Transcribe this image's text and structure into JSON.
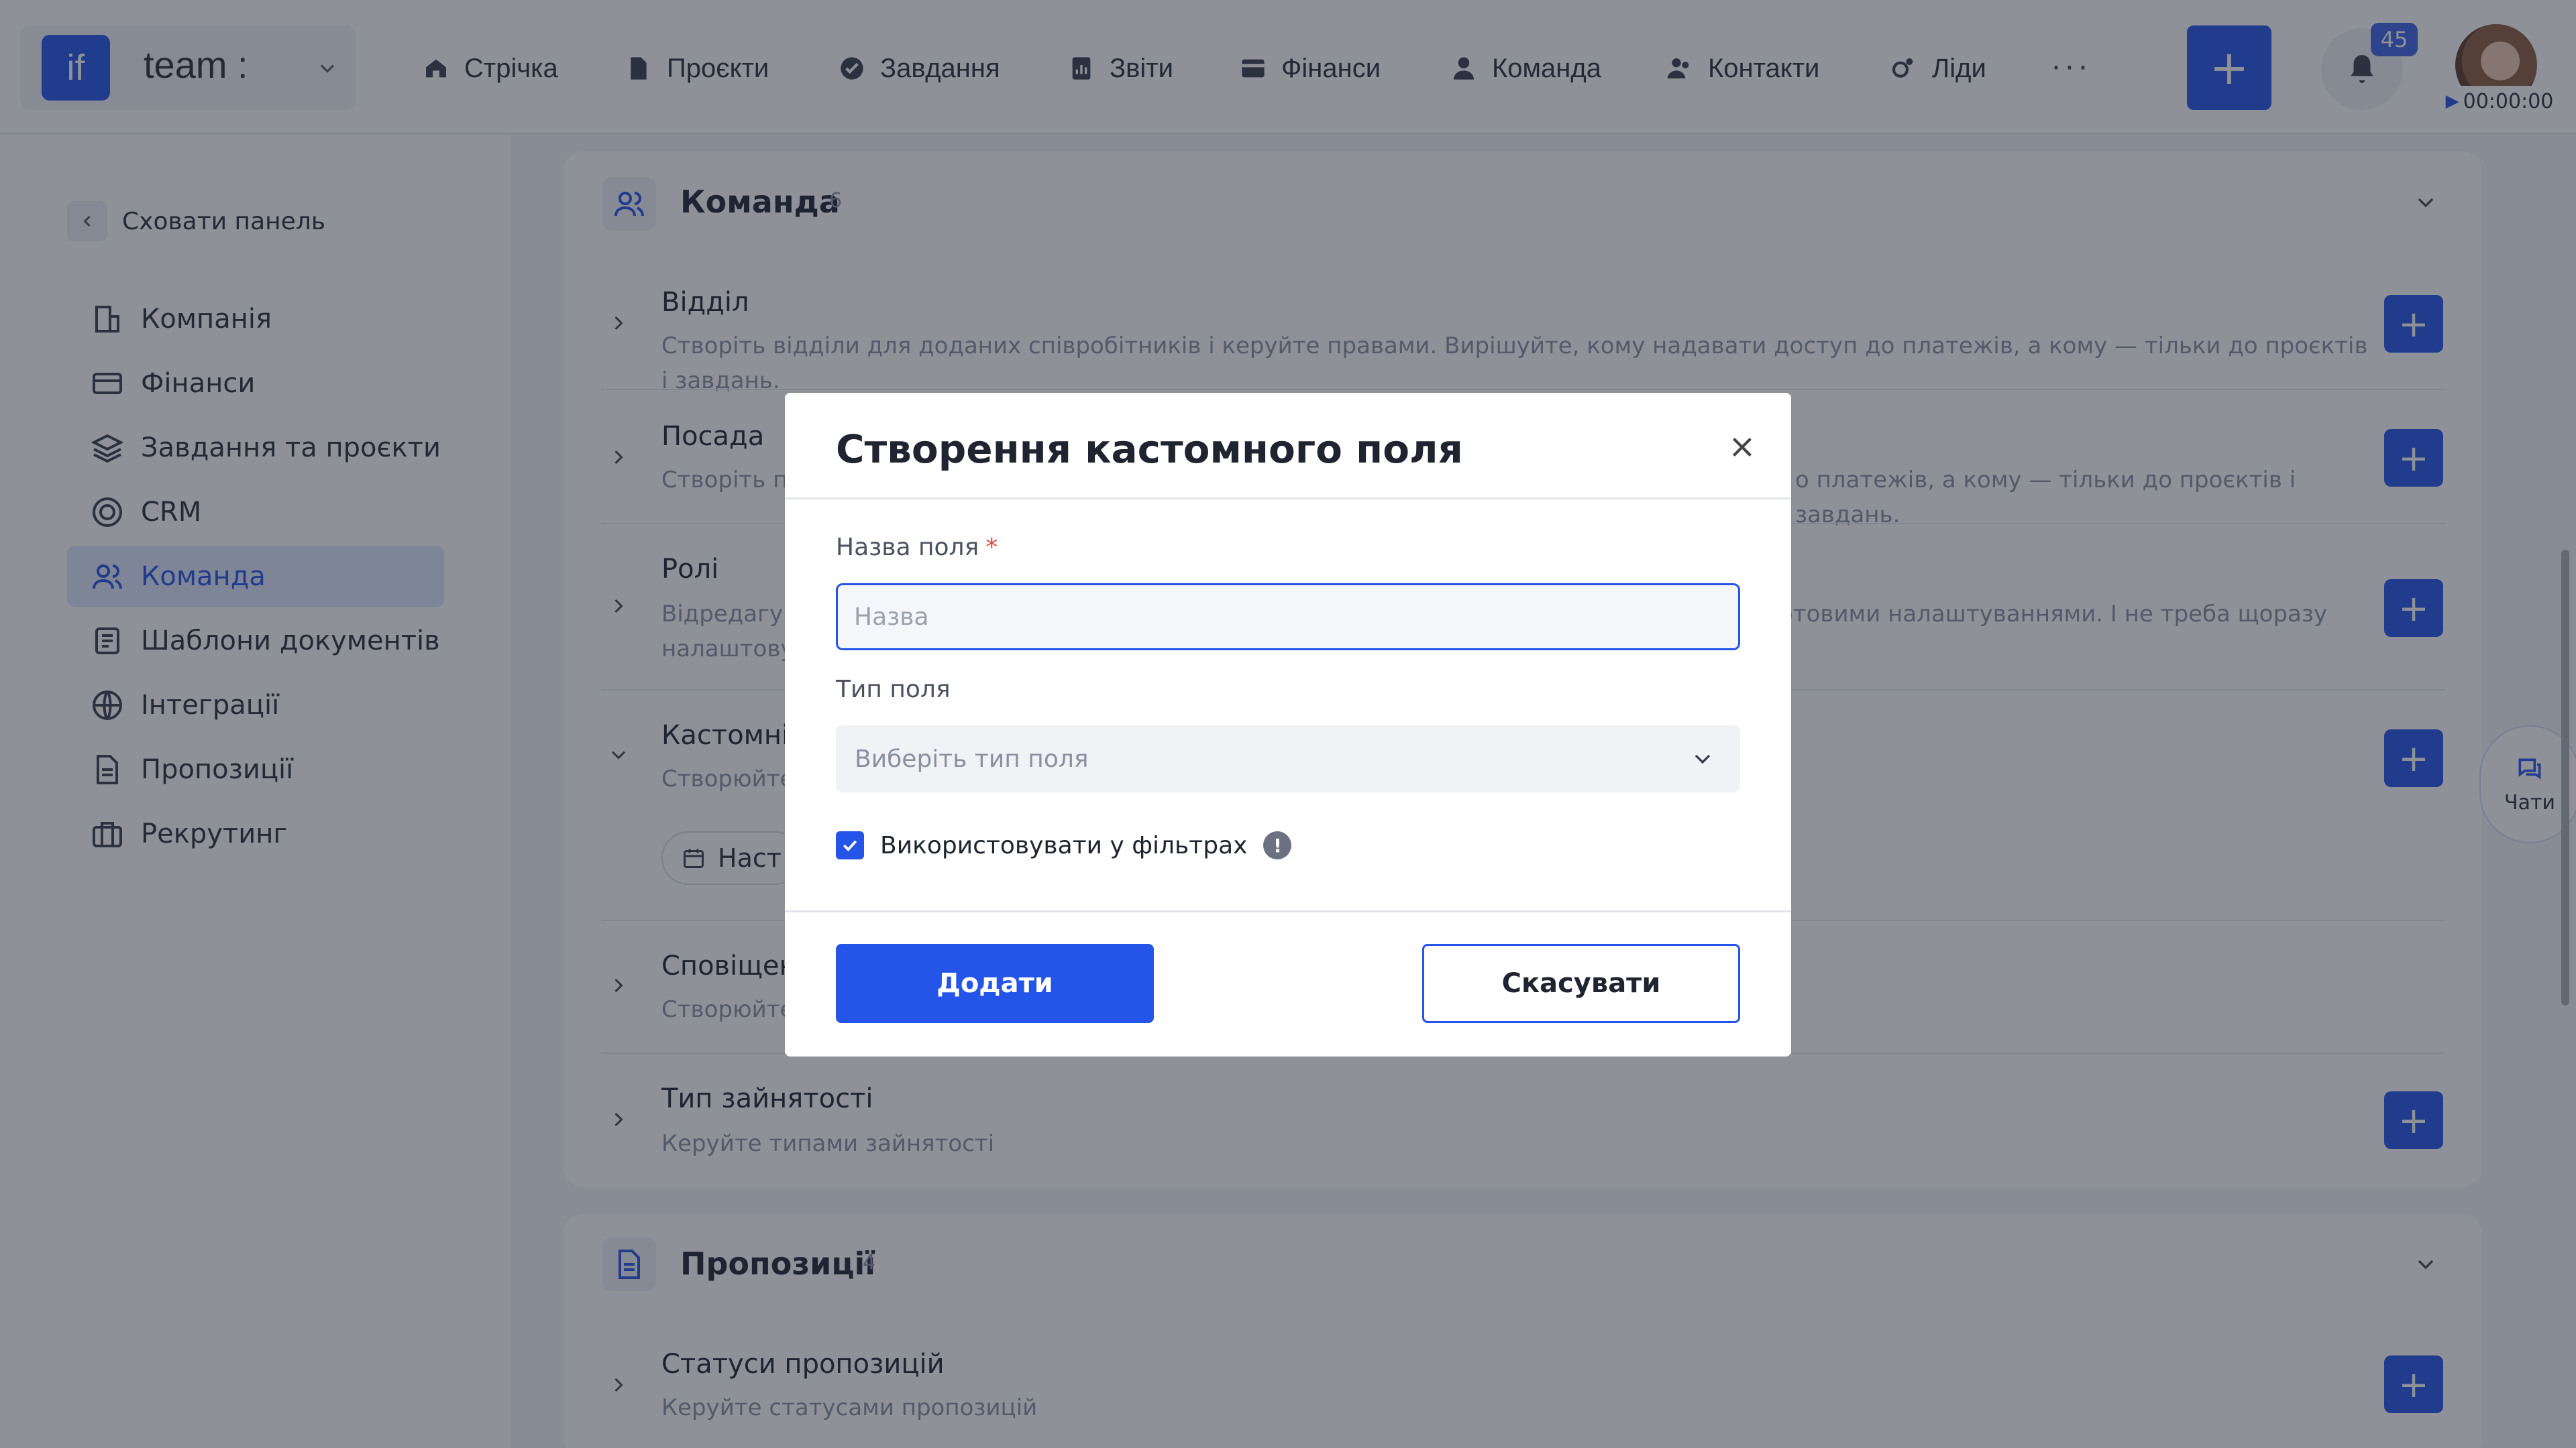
{
  "topbar": {
    "brand_logo": "if",
    "brand_name": "team :",
    "nav": [
      "Стрічка",
      "Проєкти",
      "Завдання",
      "Звіти",
      "Фінанси",
      "Команда",
      "Контакти",
      "Ліди"
    ],
    "more": "···",
    "add_label": "+",
    "notifications_count": "45",
    "timer": "00:00:00"
  },
  "sidebar": {
    "hide_panel": "Сховати панель",
    "items": [
      "Компанія",
      "Фінанси",
      "Завдання та проєкти",
      "CRM",
      "Команда",
      "Шаблони документів",
      "Інтеграції",
      "Пропозиції",
      "Рекрутинг"
    ],
    "active_index": 4
  },
  "team_card": {
    "title": "Команда",
    "count": "6",
    "rows": [
      {
        "title": "Відділ",
        "desc": "Створіть відділи для доданих співробітників і керуйте правами. Вирішуйте, кому надавати доступ до платежів, а кому — тільки до проєктів і завдань."
      },
      {
        "title": "Посада",
        "desc": "Створіть по",
        "desc_right": "о платежів, а кому — тільки до проєктів і завдань."
      },
      {
        "title": "Ролі",
        "desc": "Відредагуй",
        "desc_right": "отовими налаштуваннями. І не треба щоразу",
        "desc2": "налаштову"
      },
      {
        "title": "Кастомні",
        "desc": "Створюйте",
        "chip": "Наст"
      },
      {
        "title": "Сповіщен",
        "desc": "Створюйте"
      },
      {
        "title": "Тип зайнятості",
        "desc": "Керуйте типами зайнятості"
      }
    ]
  },
  "proposals_card": {
    "title": "Пропозиції",
    "count": "4",
    "rows": [
      {
        "title": "Статуси пропозицій",
        "desc": "Керуйте статусами пропозицій"
      }
    ]
  },
  "chats_label": "Чати",
  "modal": {
    "title": "Створення кастомного поля",
    "name_label": "Назва поля",
    "required_mark": "*",
    "name_placeholder": "Назва",
    "name_value": "",
    "type_label": "Тип поля",
    "type_placeholder": "Виберіть тип поля",
    "use_in_filters_label": "Використовувати у фільтрах",
    "use_in_filters_checked": true,
    "info_mark": "!",
    "add_button": "Додати",
    "cancel_button": "Скасувати"
  },
  "colors": {
    "accent": "#2554e8",
    "overlay": "rgba(30,36,50,0.5)",
    "required": "#e0453a"
  }
}
